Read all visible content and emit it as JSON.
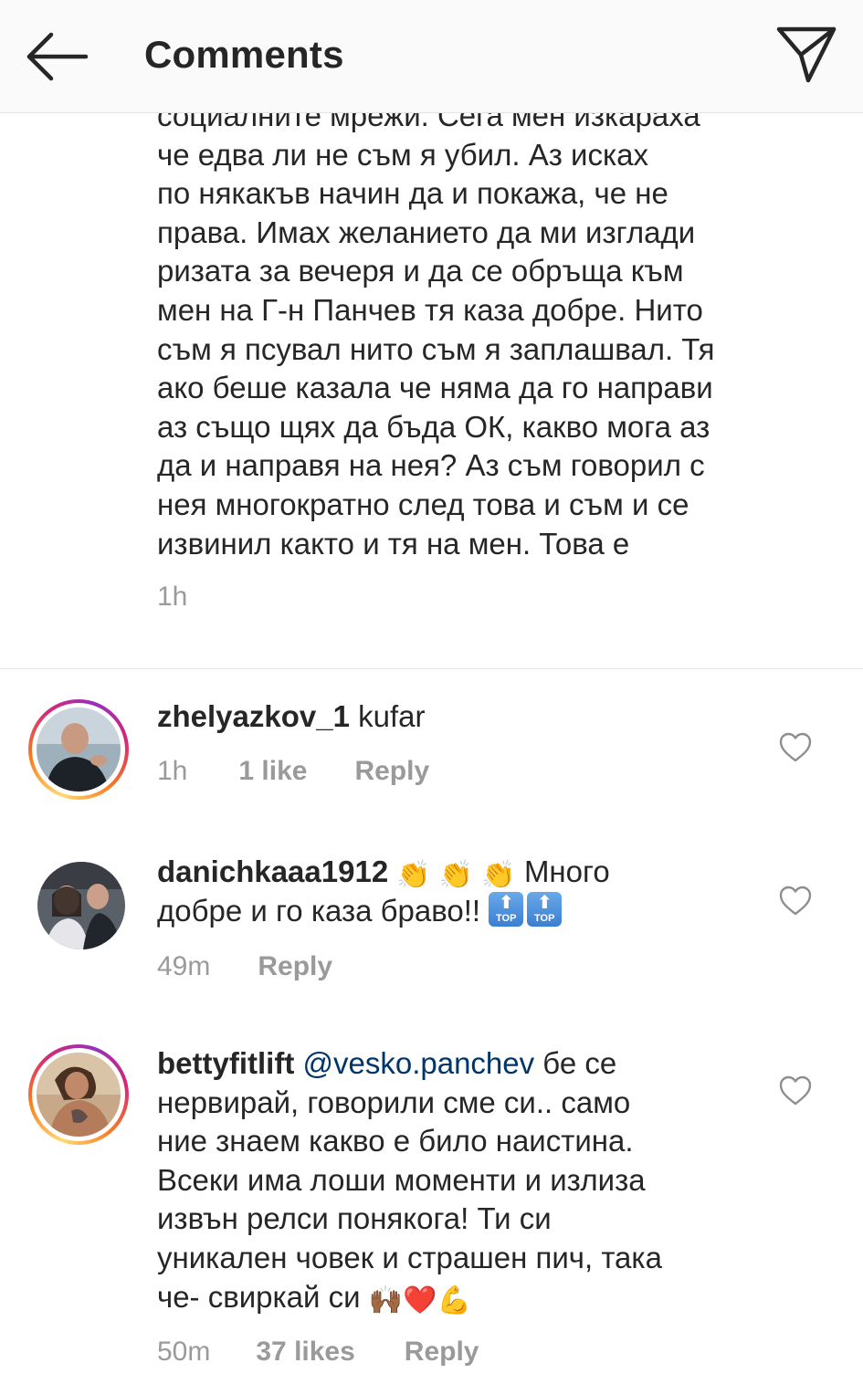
{
  "header": {
    "title": "Comments",
    "back_icon": "arrow-left-icon",
    "share_icon": "paper-plane-icon"
  },
  "partial_comment": {
    "text": "социалните мрежи. Сега мен изкараха\nче едва ли не съм я убил. Аз исках\nпо някакъв начин да и покажа, че не\nправа. Имах желанието да ми изглади\nризата за вечеря и да се обръща към\nмен на Г-н Панчев тя каза добре. Нито\nсъм я псувал  нито съм я заплашвал. Тя\nако беше казала че няма да го направи\nаз също щях да бъда ОК, какво мога аз\nда и направя на нея? Аз съм говорил с\nнея многократно след това и съм и се\nизвинил както и тя на мен. Това е",
    "time": "1h"
  },
  "comments": [
    {
      "username": "zhelyazkov_1",
      "text": "kufar",
      "time": "1h",
      "likes": "1 like",
      "reply": "Reply"
    },
    {
      "username": "danichkaaa1912",
      "text_line1": "Много",
      "text_line2": "добре и го каза браво!!",
      "time": "49m",
      "reply": "Reply",
      "emoji": "👏",
      "badge_label": "TOP",
      "badge_arrow": "⬆"
    },
    {
      "username": "bettyfitlift",
      "mention": "@vesko.panchev",
      "text_first": " бе се",
      "text_rest": "нервирай, говорили сме си.. само\nние знаем какво е било наистина.\nВсеки има лоши моменти и излиза\nизвън релси понякога! Ти си\nуникален човек и страшен пич, така\nче- свиркай си ",
      "emojis": "🙌🏾❤️💪",
      "time": "50m",
      "likes": "37 likes",
      "reply": "Reply"
    }
  ],
  "colors": {
    "text": "#262626",
    "meta": "#9a9a9a",
    "mention": "#003569",
    "divider": "#e3e3e3"
  }
}
